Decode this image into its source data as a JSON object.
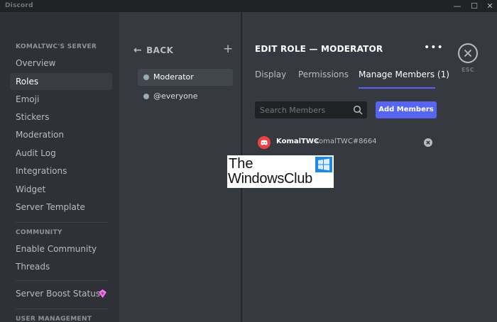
{
  "window": {
    "title": "Discord",
    "minimize_glyph": "—",
    "maximize_glyph": "☐",
    "close_glyph": "✕"
  },
  "sidebar": {
    "server_header": "KOMALTWC'S SERVER",
    "items": [
      {
        "label": "Overview"
      },
      {
        "label": "Roles",
        "active": true
      },
      {
        "label": "Emoji"
      },
      {
        "label": "Stickers"
      },
      {
        "label": "Moderation"
      },
      {
        "label": "Audit Log"
      },
      {
        "label": "Integrations"
      },
      {
        "label": "Widget"
      },
      {
        "label": "Server Template"
      }
    ],
    "community_header": "COMMUNITY",
    "community_items": [
      {
        "label": "Enable Community"
      },
      {
        "label": "Threads"
      }
    ],
    "boost_item": {
      "label": "Server Boost Status",
      "icon": "boost-gem-icon",
      "icon_color": "#ff73fa"
    },
    "user_management_header": "USER MANAGEMENT"
  },
  "roles_panel": {
    "back_label": "BACK",
    "add_glyph": "+",
    "roles": [
      {
        "label": "Moderator",
        "active": true
      },
      {
        "label": "@everyone"
      }
    ]
  },
  "editor": {
    "title": "EDIT ROLE — MODERATOR",
    "more_glyph": "•••",
    "tabs": [
      {
        "label": "Display"
      },
      {
        "label": "Permissions"
      },
      {
        "label": "Manage Members (1)",
        "active": true
      }
    ],
    "search_placeholder": "Search Members",
    "add_members_label": "Add Members",
    "members": [
      {
        "name": "KomalTWC",
        "tag": "KomalTWC#8664"
      }
    ]
  },
  "esc": {
    "label": "ESC"
  },
  "watermark": {
    "line1": "The",
    "line2": "WindowsClub"
  },
  "colors": {
    "accent": "#5865f2",
    "avatar": "#ed4245",
    "boost": "#ff73fa",
    "watermark_logo": "#1e88e5"
  }
}
